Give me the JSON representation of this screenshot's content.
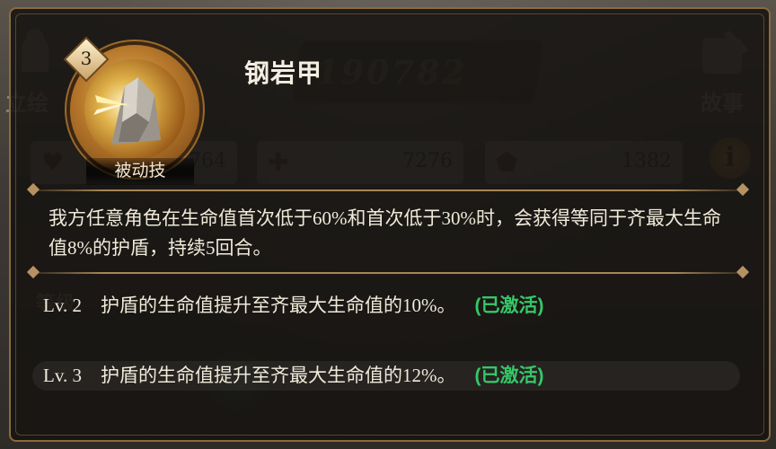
{
  "background": {
    "left_tab_label": "立绘",
    "right_tab_label": "故事",
    "power_number": "190782",
    "stats": [
      {
        "icon": "heart-icon",
        "value": "764"
      },
      {
        "icon": "sword-icon",
        "value": "7276"
      },
      {
        "icon": "shield-icon",
        "value": "1382"
      }
    ],
    "info_label": "i",
    "level_label": "等级"
  },
  "skill": {
    "level": "3",
    "type": "被动技",
    "name": "钢岩甲",
    "description": "我方任意角色在生命值首次低于60%和首次低于30%时，会获得等同于齐最大生命值8%的护盾，持续5回合。",
    "upgrades": [
      {
        "level": "Lv. 2",
        "text": "护盾的生命值提升至齐最大生命值的10%。",
        "status": "(已激活)"
      },
      {
        "level": "Lv. 3",
        "text": "护盾的生命值提升至齐最大生命值的12%。",
        "status": "(已激活)"
      }
    ]
  },
  "colors": {
    "activated": "#36c768",
    "frame": "#8a6b3e",
    "ring": "#b8792c"
  }
}
